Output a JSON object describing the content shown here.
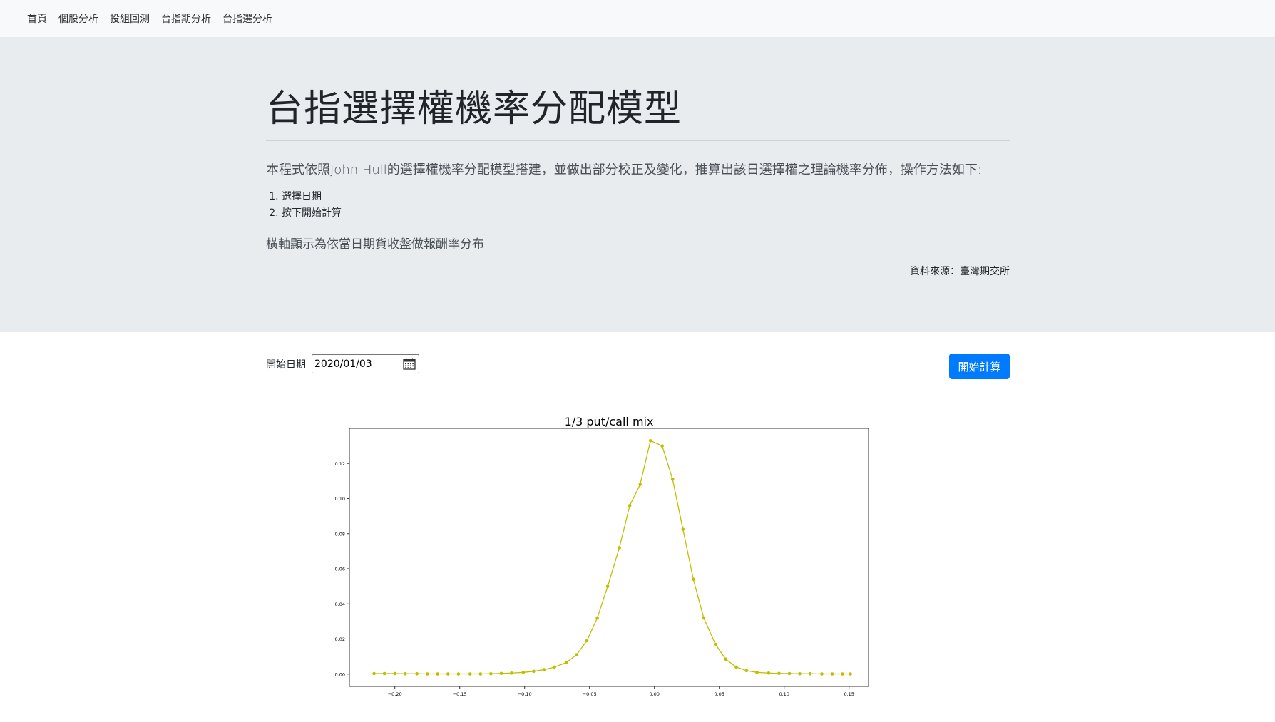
{
  "nav": {
    "items": [
      {
        "label": "首頁"
      },
      {
        "label": "個股分析"
      },
      {
        "label": "投組回測"
      },
      {
        "label": "台指期分析"
      },
      {
        "label": "台指選分析"
      }
    ]
  },
  "hero": {
    "title": "台指選擇權機率分配模型",
    "lead": "本程式依照John Hull的選擇權機率分配模型搭建，並做出部分校正及變化，推算出該日選擇權之理論機率分佈，操作方法如下:",
    "steps": [
      "選擇日期",
      "按下開始計算"
    ],
    "note": "橫軸顯示為依當日期貨收盤做報酬率分布",
    "source": "資料來源：臺灣期交所"
  },
  "form": {
    "date_label": "開始日期",
    "date_value": "2020/01/03",
    "calendar_icon": "calendar-icon",
    "submit_label": "開始計算"
  },
  "colors": {
    "accent": "#007bff",
    "series": "#bfbf00",
    "jumbotron": "#e9ecef",
    "navbar": "#f8f9fa"
  },
  "chart_data": {
    "type": "line",
    "title": "1/3 put/call mix",
    "xlabel": "",
    "ylabel": "",
    "xlim": [
      -0.235,
      0.165
    ],
    "ylim": [
      -0.007,
      0.14
    ],
    "grid": false,
    "x_ticks": [
      -0.2,
      -0.15,
      -0.1,
      -0.05,
      0.0,
      0.05,
      0.1,
      0.15
    ],
    "x_tick_labels": [
      "−0.20",
      "−0.15",
      "−0.10",
      "−0.05",
      "0.00",
      "0.05",
      "0.10",
      "0.15"
    ],
    "y_ticks": [
      0.0,
      0.02,
      0.04,
      0.06,
      0.08,
      0.1,
      0.12
    ],
    "y_tick_labels": [
      "0.00",
      "0.02",
      "0.04",
      "0.06",
      "0.08",
      "0.10",
      "0.12"
    ],
    "series": [
      {
        "x": [
          -0.216,
          -0.208,
          -0.2,
          -0.192,
          -0.183,
          -0.175,
          -0.167,
          -0.159,
          -0.151,
          -0.142,
          -0.134,
          -0.126,
          -0.118,
          -0.11,
          -0.101,
          -0.093,
          -0.085,
          -0.077,
          -0.068,
          -0.06,
          -0.052,
          -0.044,
          -0.036,
          -0.027,
          -0.019,
          -0.011,
          -0.003,
          0.006,
          0.014,
          0.022,
          0.03,
          0.038,
          0.047,
          0.055,
          0.063,
          0.071,
          0.079,
          0.088,
          0.096,
          0.104,
          0.112,
          0.12,
          0.129,
          0.137,
          0.145,
          0.151
        ],
        "y": [
          0.0003,
          0.0003,
          0.0003,
          0.0002,
          0.0002,
          0.0001,
          0.0001,
          0.0001,
          0.0001,
          0.0001,
          0.0001,
          0.0002,
          0.0004,
          0.0006,
          0.001,
          0.0016,
          0.0025,
          0.004,
          0.0065,
          0.011,
          0.019,
          0.032,
          0.05,
          0.072,
          0.096,
          0.108,
          0.133,
          0.13,
          0.111,
          0.0825,
          0.054,
          0.032,
          0.017,
          0.0085,
          0.004,
          0.002,
          0.001,
          0.0006,
          0.0004,
          0.0003,
          0.0002,
          0.0002,
          0.0001,
          0.0001,
          0.0001,
          0.0001
        ]
      }
    ]
  }
}
